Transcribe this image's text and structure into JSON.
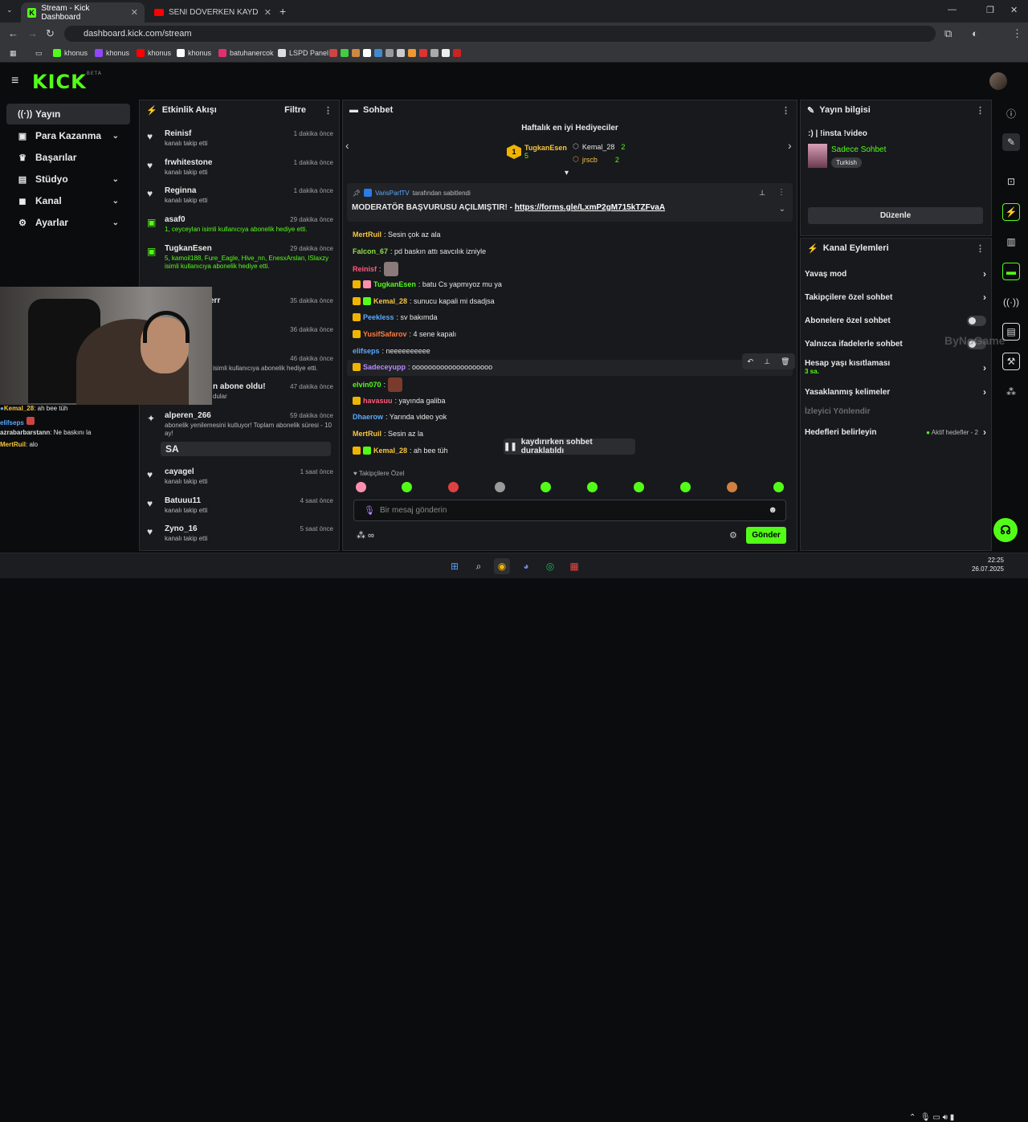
{
  "browser": {
    "tabs": [
      {
        "title": "Stream - Kick Dashboard",
        "active": true
      },
      {
        "title": "SENİ DÖVERKEN KAYDEDECEM",
        "active": false
      }
    ],
    "url": "dashboard.kick.com/stream",
    "bookmarks": [
      "khonus",
      "khonus",
      "khonus",
      "khonus",
      "batuhanercok",
      "LSPD Panel"
    ]
  },
  "app": {
    "logo": "KICK",
    "logo_sup": "BETA"
  },
  "sidebar": {
    "items": [
      {
        "label": "Yayın",
        "icon": "broadcast-icon"
      },
      {
        "label": "Para Kazanma",
        "icon": "money-icon"
      },
      {
        "label": "Başarılar",
        "icon": "trophy-icon"
      },
      {
        "label": "Stüdyo",
        "icon": "studio-icon"
      },
      {
        "label": "Kanal",
        "icon": "channel-icon"
      },
      {
        "label": "Ayarlar",
        "icon": "gear-icon"
      }
    ]
  },
  "feed": {
    "title": "Etkinlik Akışı",
    "filter_label": "Filtre",
    "items": [
      {
        "user": "Reinisf",
        "time": "1 dakika önce",
        "desc": "kanalı takip etti",
        "icon": "heart-icon"
      },
      {
        "user": "frwhitestone",
        "time": "1 dakika önce",
        "desc": "kanalı takip etti",
        "icon": "heart-icon"
      },
      {
        "user": "Reginna",
        "time": "1 dakika önce",
        "desc": "kanalı takip etti",
        "icon": "heart-icon"
      },
      {
        "user": "asaf0",
        "time": "29 dakika önce",
        "desc": "1, ceyceylan isimli kullanıcıya abonelik hediye etti.",
        "icon": "gift-icon"
      },
      {
        "user": "TugkanEsen",
        "time": "29 dakika önce",
        "desc": "5, kamoil188, Fure_Eagle, Hive_nn, EnesxArslan, lSlaxzy isimli kullanıcıya abonelik hediye etti.",
        "icon": "gift-icon"
      },
      {
        "user": "err",
        "time": "35 dakika önce",
        "desc": "",
        "icon": "heart-icon"
      },
      {
        "user": "",
        "time": "36 dakika önce",
        "desc": "",
        "icon": "heart-icon"
      },
      {
        "user": "",
        "time": "46 dakika önce",
        "desc": "isimli kullanıcıya abonelik hediye etti.",
        "icon": "gift-icon"
      },
      {
        "user": "n abone oldu!",
        "time": "47 dakika önce",
        "desc": "dular",
        "icon": "star-icon"
      },
      {
        "user": "alperen_266",
        "time": "59 dakika önce",
        "desc": "abonelik yenilemesini kutluyor! Toplam abonelik süresi - 10 ay!",
        "icon": "star-icon"
      },
      {
        "user": "cayagel",
        "time": "1 saat önce",
        "desc": "kanalı takip etti",
        "icon": "heart-icon"
      },
      {
        "user": "Batuuu11",
        "time": "4 saat önce",
        "desc": "kanalı takip etti",
        "icon": "heart-icon"
      },
      {
        "user": "Zyno_16",
        "time": "5 saat önce",
        "desc": "kanalı takip etti",
        "icon": "heart-icon"
      }
    ],
    "sa_message": "SA"
  },
  "chat": {
    "title": "Sohbet",
    "gifters_title": "Haftalık en iyi Hediyeciler",
    "gifters": [
      {
        "name": "TugkanEsen",
        "count": "5",
        "rank": "1"
      },
      {
        "name": "Kemal_28",
        "count": "2"
      },
      {
        "name": "jrscb",
        "count": "2"
      }
    ],
    "pinned_by_user": "VarisParfTV",
    "pinned_by_text": "tarafından sabitlendi",
    "pinned_text": "MODERATÖR BAŞVURUSU AÇILMIŞTIR! - ",
    "pinned_link": "https://forms.gle/LxmP2gM715kTZFvaA",
    "messages": [
      {
        "user": "MertRuil",
        "text": ": Sesin çok az ala",
        "color": "#f5c542"
      },
      {
        "user": "Falcon_67",
        "text": ": pd baskın attı savcılık izniyle",
        "color": "#8fe04a"
      },
      {
        "user": "Reinisf",
        "text": ":",
        "color": "#ff5a7a"
      },
      {
        "user": "TugkanEsen",
        "text": ": batu Cs yapmıyoz mu ya",
        "color": "#53fc18"
      },
      {
        "user": "Kemal_28",
        "text": ": sunucu kapali mi dsadjsa",
        "color": "#f5c542"
      },
      {
        "user": "Peekless",
        "text": ": sv bakımda",
        "color": "#5aa9ff"
      },
      {
        "user": "YusifSafarov",
        "text": ": 4 sene kapalı",
        "color": "#ff7a3d"
      },
      {
        "user": "elifseps",
        "text": ": neeeeeeeeee",
        "color": "#5aa9ff"
      },
      {
        "user": "Sadeceyupp",
        "text": ": oooooooooooooooooooo",
        "color": "#b78bff"
      },
      {
        "user": "elvin070",
        "text": ":",
        "color": "#53fc18"
      },
      {
        "user": "havasuu",
        "text": ": yayında galiba",
        "color": "#ff5a7a"
      },
      {
        "user": "Dhaerow",
        "text": ": Yarında video yok",
        "color": "#5aa9ff"
      },
      {
        "user": "MertRuil",
        "text": ": Sesin az la",
        "color": "#f5c542"
      },
      {
        "user": "Kemal_28",
        "text": ": ah bee tüh",
        "color": "#f5c542"
      }
    ],
    "paused_label": "kaydırırken sohbet duraklatıldı",
    "followers_only": "Takipçilere Özel",
    "input_placeholder": "Bir mesaj gönderin",
    "send_label": "Gönder"
  },
  "stream_info": {
    "title": "Yayın bilgisi",
    "stream_title": ":) | !insta !video",
    "category": "Sadece Sohbet",
    "language": "Turkish",
    "edit_label": "Düzenle"
  },
  "channel_actions": {
    "title": "Kanal Eylemleri",
    "items": [
      {
        "label": "Yavaş mod",
        "type": "chevron"
      },
      {
        "label": "Takipçilere özel sohbet",
        "type": "chevron"
      },
      {
        "label": "Abonelere özel sohbet",
        "type": "toggle"
      },
      {
        "label": "Yalnızca ifadelerle sohbet",
        "type": "toggle"
      },
      {
        "label": "Hesap yaşı kısıtlaması",
        "sub": "3 sa.",
        "type": "chevron"
      },
      {
        "label": "Yasaklanmış kelimeler",
        "type": "chevron"
      },
      {
        "label": "İzleyici Yönlendir",
        "type": "disabled"
      },
      {
        "label": "Hedefleri belirleyin",
        "sub": "Aktif hedefler - 2",
        "type": "chevron"
      }
    ]
  },
  "cam_chat": [
    {
      "user": "Kemal_28",
      "text": ": ah bee tüh"
    },
    {
      "user": "elifseps",
      "text": ": Ne baskını la"
    },
    {
      "user": "azrabarbarstann",
      "text": ": Ne baskını la"
    },
    {
      "user": "MertRuil",
      "text": ": alo"
    }
  ],
  "watermark": "ByNoGame",
  "clock": {
    "time": "22:25",
    "date": "26.07.2025"
  },
  "colors": {
    "accent": "#53fc18",
    "bg": "#0b0c0e",
    "panel": "#18191c"
  }
}
